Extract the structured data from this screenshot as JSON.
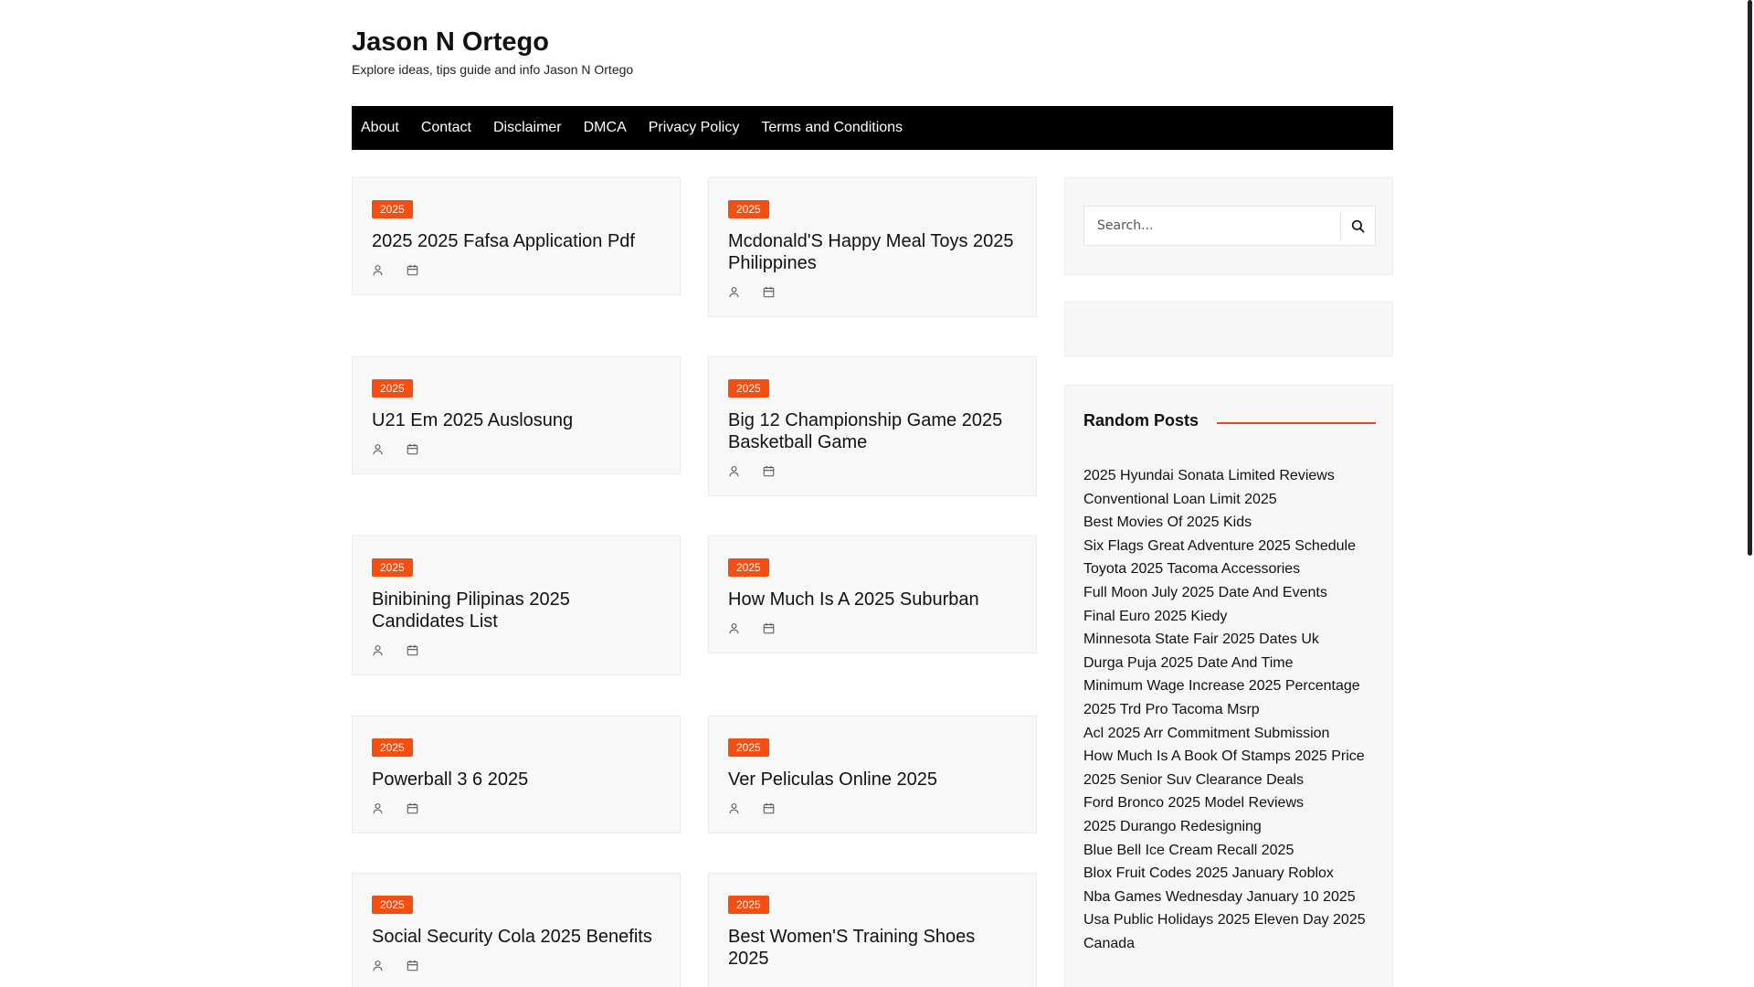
{
  "site": {
    "title": "Jason N Ortego",
    "description": "Explore ideas, tips guide and info Jason N Ortego"
  },
  "nav": {
    "items": [
      "About",
      "Contact",
      "Disclaimer",
      "DMCA",
      "Privacy Policy",
      "Terms and Conditions"
    ]
  },
  "posts": [
    {
      "category": "2025",
      "title": "2025 2025 Fafsa Application Pdf"
    },
    {
      "category": "2025",
      "title": "Mcdonald'S Happy Meal Toys 2025 Philippines"
    },
    {
      "category": "2025",
      "title": "U21 Em 2025 Auslosung"
    },
    {
      "category": "2025",
      "title": "Big 12 Championship Game 2025 Basketball Game"
    },
    {
      "category": "2025",
      "title": "Binibining Pilipinas 2025 Candidates List"
    },
    {
      "category": "2025",
      "title": "How Much Is A 2025 Suburban"
    },
    {
      "category": "2025",
      "title": "Powerball 3 6 2025"
    },
    {
      "category": "2025",
      "title": "Ver Peliculas Online 2025"
    },
    {
      "category": "2025",
      "title": "Social Security Cola 2025 Benefits"
    },
    {
      "category": "2025",
      "title": "Best Women'S Training Shoes 2025"
    }
  ],
  "sidebar": {
    "search_placeholder": "Search...",
    "random_posts_title": "Random Posts",
    "random_posts": [
      "2025 Hyundai Sonata Limited Reviews",
      "Conventional Loan Limit 2025",
      "Best Movies Of 2025 Kids",
      "Six Flags Great Adventure 2025 Schedule",
      "Toyota 2025 Tacoma Accessories",
      "Full Moon July 2025 Date And Events",
      "Final Euro 2025 Kiedy",
      "Minnesota State Fair 2025 Dates Uk",
      "Durga Puja 2025 Date And Time",
      "Minimum Wage Increase 2025 Percentage",
      "2025 Trd Pro Tacoma Msrp",
      "Acl 2025 Arr Commitment Submission",
      "How Much Is A Book Of Stamps 2025 Price",
      "2025 Senior Suv Clearance Deals",
      "Ford Bronco 2025 Model Reviews",
      "2025 Durango Redesigning",
      "Blue Bell Ice Cream Recall 2025",
      "Blox Fruit Codes 2025 January Roblox",
      "Nba Games Wednesday January 10 2025",
      "Usa Public Holidays 2025 Eleven Day 2025 Canada"
    ]
  },
  "colors": {
    "accent": "#f44f13",
    "nav_bg": "#000000",
    "card_bg": "#f8f8f8"
  }
}
